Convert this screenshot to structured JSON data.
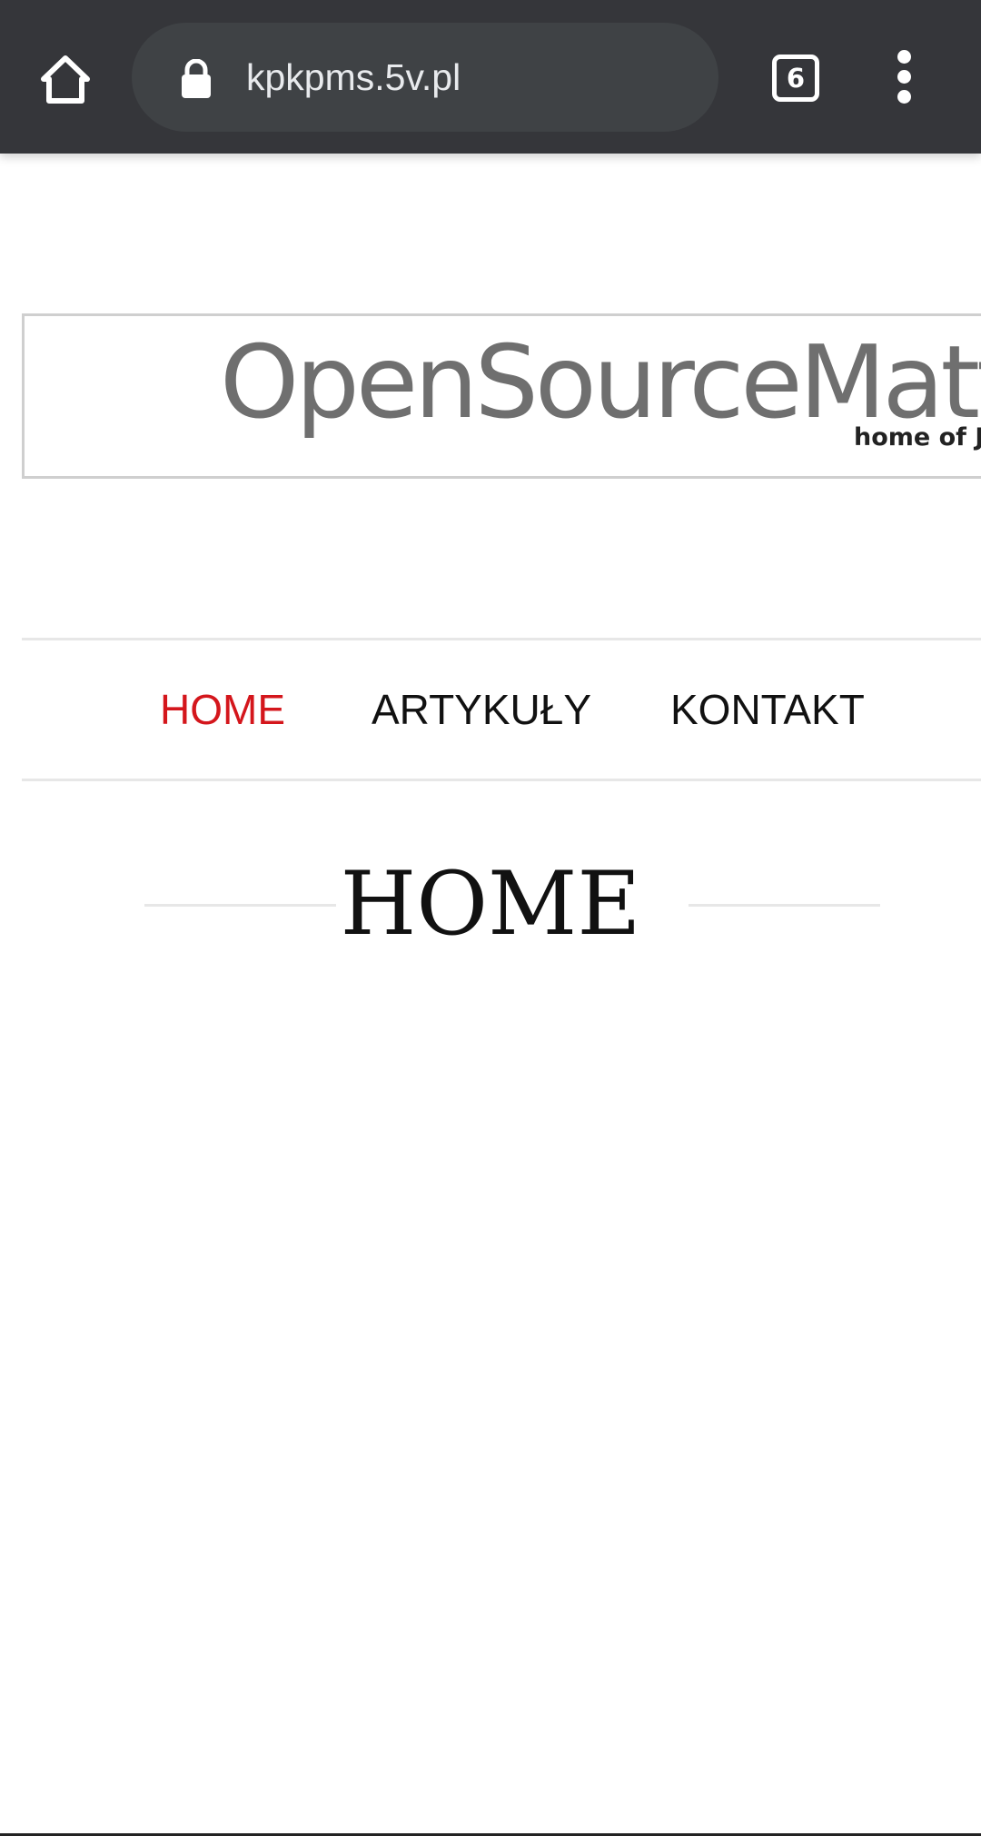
{
  "browser": {
    "url": "kpkpms.5v.pl",
    "tab_count": "6",
    "icons": {
      "home": "home-icon",
      "lock": "lock-icon",
      "tabs": "tab-switcher-icon",
      "menu": "more-vert-icon"
    }
  },
  "banner": {
    "title": "OpenSourceMatte",
    "subtitle": "home of Jo"
  },
  "nav": {
    "items": [
      {
        "label": "HOME",
        "active": true
      },
      {
        "label": "ARTYKUŁY",
        "active": false
      },
      {
        "label": "KONTAKT",
        "active": false
      }
    ]
  },
  "main": {
    "heading": "HOME"
  },
  "colors": {
    "toolbar_bg": "#35363a",
    "omnibox_bg": "#3f4245",
    "nav_active": "#d4161c",
    "text": "#111111",
    "divider": "#e7e7e7"
  }
}
